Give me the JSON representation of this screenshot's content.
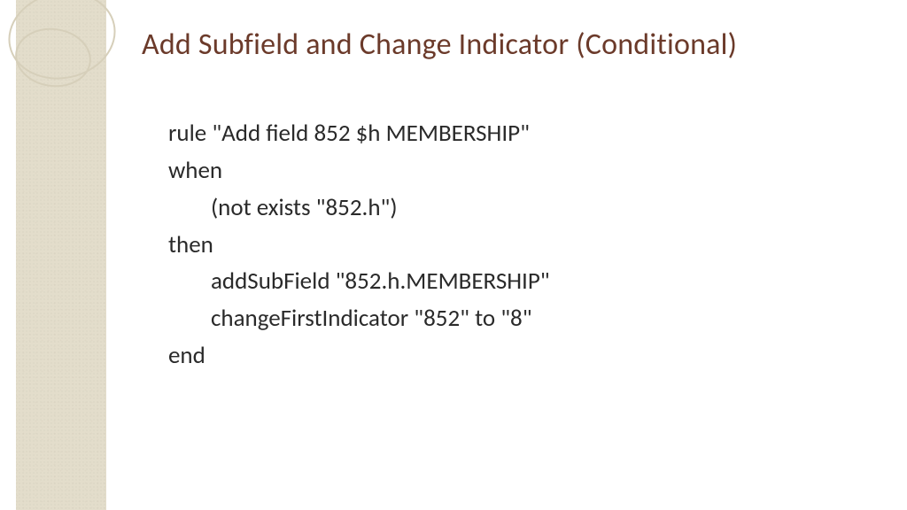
{
  "title": "Add Subfield and Change Indicator (Conditional)",
  "code": {
    "l1": "rule \"Add field 852 $h MEMBERSHIP\"",
    "l2": "when",
    "l3": "(not exists \"852.h\")",
    "l4": "then",
    "l5": "addSubField \"852.h.MEMBERSHIP\"",
    "l6": "changeFirstIndicator \"852\" to \"8\"",
    "l7": "end"
  }
}
